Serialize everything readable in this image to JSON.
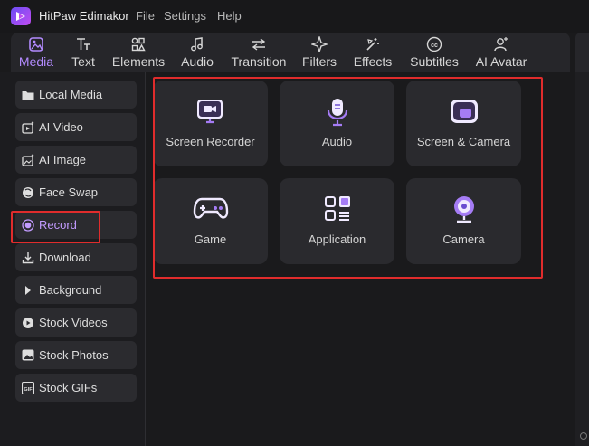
{
  "app": {
    "title": "HitPaw Edimakor"
  },
  "menu": [
    {
      "label": "File"
    },
    {
      "label": "Settings"
    },
    {
      "label": "Help"
    }
  ],
  "tabs": [
    {
      "label": "Media",
      "icon": "media-icon",
      "active": true
    },
    {
      "label": "Text",
      "icon": "text-icon"
    },
    {
      "label": "Elements",
      "icon": "elements-icon"
    },
    {
      "label": "Audio",
      "icon": "music-note-icon"
    },
    {
      "label": "Transition",
      "icon": "transition-arrows-icon"
    },
    {
      "label": "Filters",
      "icon": "sparkle-icon"
    },
    {
      "label": "Effects",
      "icon": "magic-wand-icon"
    },
    {
      "label": "Subtitles",
      "icon": "cc-icon"
    },
    {
      "label": "AI Avatar",
      "icon": "avatar-icon"
    }
  ],
  "sidebar": {
    "items": [
      {
        "label": "Local Media",
        "icon": "folder-icon"
      },
      {
        "label": "AI Video",
        "icon": "ai-video-icon"
      },
      {
        "label": "AI Image",
        "icon": "ai-image-icon"
      },
      {
        "label": "Face Swap",
        "icon": "face-swap-icon"
      },
      {
        "label": "Record",
        "icon": "record-icon",
        "active": true
      },
      {
        "label": "Download",
        "icon": "download-icon"
      },
      {
        "label": "Background",
        "icon": "play-triangle-icon"
      },
      {
        "label": "Stock Videos",
        "icon": "stock-video-icon"
      },
      {
        "label": "Stock Photos",
        "icon": "stock-photo-icon"
      },
      {
        "label": "Stock GIFs",
        "icon": "gif-icon"
      }
    ]
  },
  "record_options": [
    {
      "label": "Screen Recorder",
      "icon": "screen-recorder-icon"
    },
    {
      "label": "Audio",
      "icon": "microphone-icon"
    },
    {
      "label": "Screen & Camera",
      "icon": "screen-camera-icon"
    },
    {
      "label": "Game",
      "icon": "gamepad-icon"
    },
    {
      "label": "Application",
      "icon": "application-grid-icon"
    },
    {
      "label": "Camera",
      "icon": "webcam-icon"
    }
  ],
  "colors": {
    "accent": "#b38bff",
    "highlight_border": "#e02c2c",
    "background": "#1a1a1c",
    "card": "#2a2a2e"
  }
}
